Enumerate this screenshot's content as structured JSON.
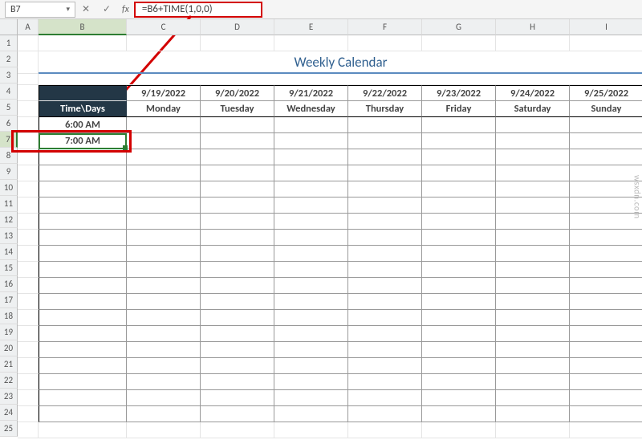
{
  "nameBox": "B7",
  "formula": "=B6+TIME(1,0,0)",
  "fxLabel": "fx",
  "cancelIcon": "✕",
  "confirmIcon": "✓",
  "dropdownIcon": "▾",
  "watermark": "wsxdn.com",
  "columns": [
    "A",
    "B",
    "C",
    "D",
    "E",
    "F",
    "G",
    "H",
    "I"
  ],
  "rows": [
    "1",
    "2",
    "3",
    "4",
    "5",
    "6",
    "7",
    "8",
    "9",
    "10",
    "11",
    "12",
    "13",
    "14",
    "15",
    "16",
    "17",
    "18",
    "19",
    "20",
    "21",
    "22",
    "23",
    "24",
    "25"
  ],
  "title": "Weekly Calendar",
  "headerDates": [
    "9/19/2022",
    "9/20/2022",
    "9/21/2022",
    "9/22/2022",
    "9/23/2022",
    "9/24/2022",
    "9/25/2022"
  ],
  "headerDays": [
    "Monday",
    "Tuesday",
    "Wednesday",
    "Thursday",
    "Friday",
    "Saturday",
    "Sunday"
  ],
  "timeLabel": "Time\\Days",
  "times": [
    "6:00 AM",
    "7:00 AM"
  ],
  "chart_data": {
    "type": "table",
    "title": "Weekly Calendar",
    "columns": [
      {
        "date": "9/19/2022",
        "day": "Monday"
      },
      {
        "date": "9/20/2022",
        "day": "Tuesday"
      },
      {
        "date": "9/21/2022",
        "day": "Wednesday"
      },
      {
        "date": "9/22/2022",
        "day": "Thursday"
      },
      {
        "date": "9/23/2022",
        "day": "Friday"
      },
      {
        "date": "9/24/2022",
        "day": "Saturday"
      },
      {
        "date": "9/25/2022",
        "day": "Sunday"
      }
    ],
    "row_times": [
      "6:00 AM",
      "7:00 AM"
    ],
    "formula_B7": "=B6+TIME(1,0,0)"
  }
}
